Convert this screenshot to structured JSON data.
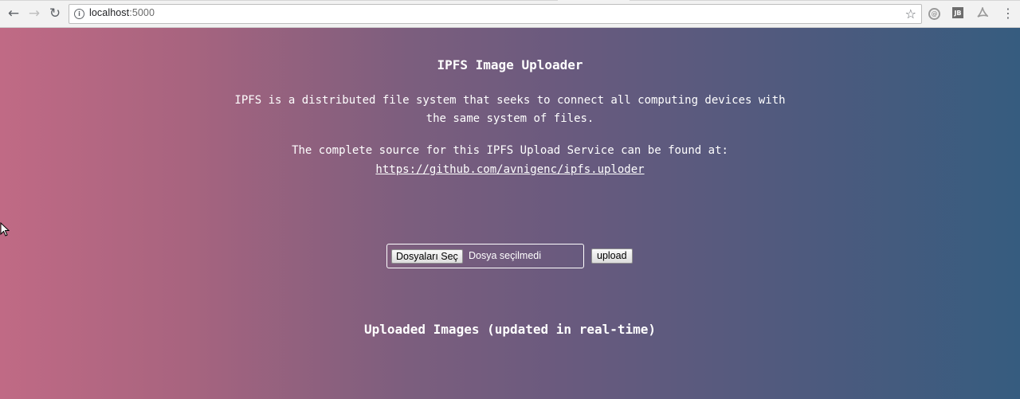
{
  "browser": {
    "nav": {
      "back_glyph": "←",
      "forward_glyph": "→",
      "reload_glyph": "↻"
    },
    "url_host": "localhost",
    "url_port": ":5000",
    "info_glyph": "i",
    "bookmark_glyph": "☆",
    "extensions": [
      {
        "icon": "circular-extension-icon",
        "glyph": "@"
      },
      {
        "icon": "jetbrains-extension-icon",
        "glyph": "JB"
      },
      {
        "icon": "pdf-extension-icon",
        "glyph": "⯆"
      },
      {
        "icon": "menu-kebab-icon",
        "glyph": "⋮"
      }
    ]
  },
  "page": {
    "title": "IPFS Image Uploader",
    "description": "IPFS is a distributed file system that seeks to connect all computing devices with the same system of files.",
    "source_text": "The complete source for this IPFS Upload Service can be found at:",
    "source_link": "https://github.com/avnigenc/ipfs.uploder",
    "file_button_label": "Dosyaları Seç",
    "file_status": "Dosya seçilmedi",
    "upload_label": "upload",
    "uploaded_title": "Uploaded Images (updated in real-time)"
  },
  "colors": {
    "gradient_left": "#c06a85",
    "gradient_middle": "#6a5a7e",
    "gradient_right": "#365c7f",
    "text": "#ffffff"
  }
}
